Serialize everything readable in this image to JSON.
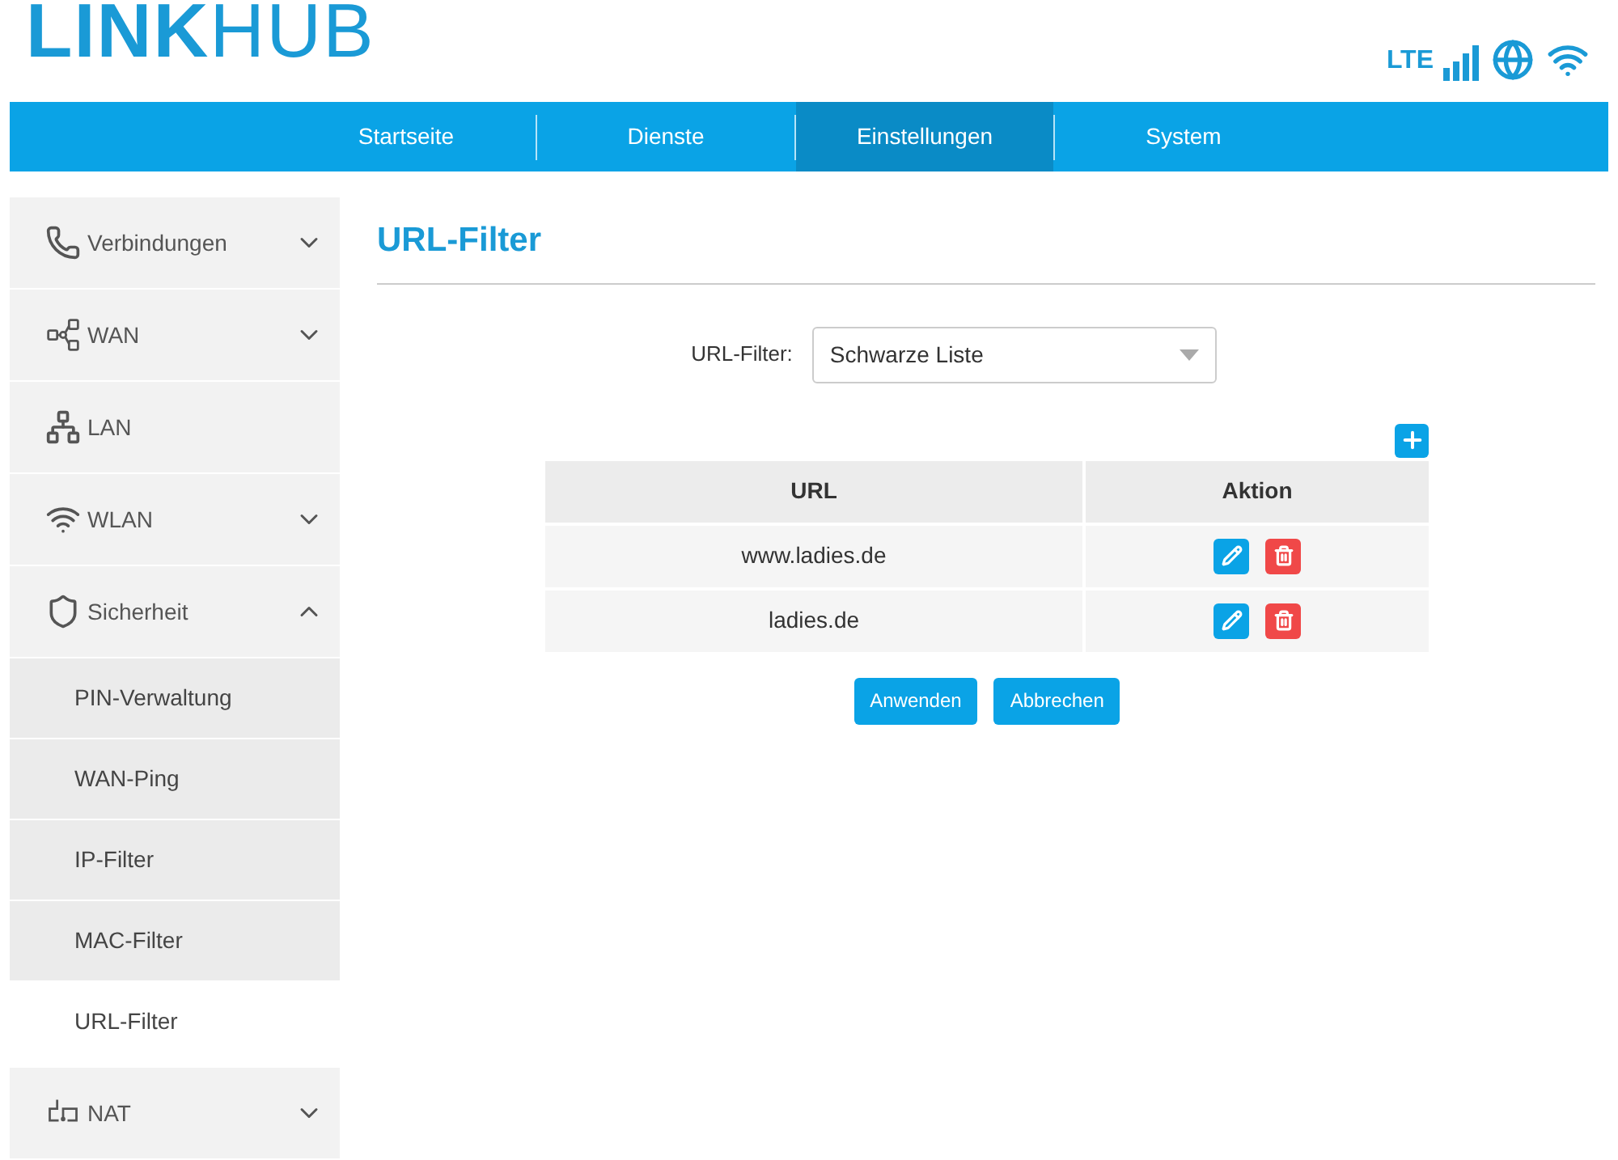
{
  "logo": "**LINK**HUB",
  "status": {
    "network": "LTE"
  },
  "nav": [
    {
      "label": "Startseite",
      "selected": false
    },
    {
      "label": "Dienste",
      "selected": false
    },
    {
      "label": "Einstellungen",
      "selected": true
    },
    {
      "label": "System",
      "selected": false
    }
  ],
  "sidebar": {
    "items": [
      {
        "label": "Verbindungen",
        "kind": "phone",
        "expanded": false,
        "expandable": true
      },
      {
        "label": "WAN",
        "kind": "wan",
        "expanded": false,
        "expandable": true
      },
      {
        "label": "LAN",
        "kind": "lan",
        "expandable": false
      },
      {
        "label": "WLAN",
        "kind": "wifi",
        "expanded": false,
        "expandable": true
      },
      {
        "label": "Sicherheit",
        "kind": "shield",
        "expanded": true,
        "expandable": true,
        "children": [
          {
            "label": "PIN-Verwaltung",
            "selected": false
          },
          {
            "label": "WAN-Ping",
            "selected": false
          },
          {
            "label": "IP-Filter",
            "selected": false
          },
          {
            "label": "MAC-Filter",
            "selected": false
          },
          {
            "label": "URL-Filter",
            "selected": true
          }
        ]
      },
      {
        "label": "NAT",
        "kind": "nat",
        "expanded": false,
        "expandable": true
      }
    ]
  },
  "page": {
    "title": "URL-Filter",
    "filter_label": "URL-Filter:",
    "filter_value": "Schwarze Liste",
    "table": {
      "columns": [
        "URL",
        "Aktion"
      ],
      "rows": [
        {
          "url": "www.ladies.de"
        },
        {
          "url": "ladies.de"
        }
      ]
    },
    "buttons": [
      "Anwenden",
      "Abbrechen"
    ]
  }
}
